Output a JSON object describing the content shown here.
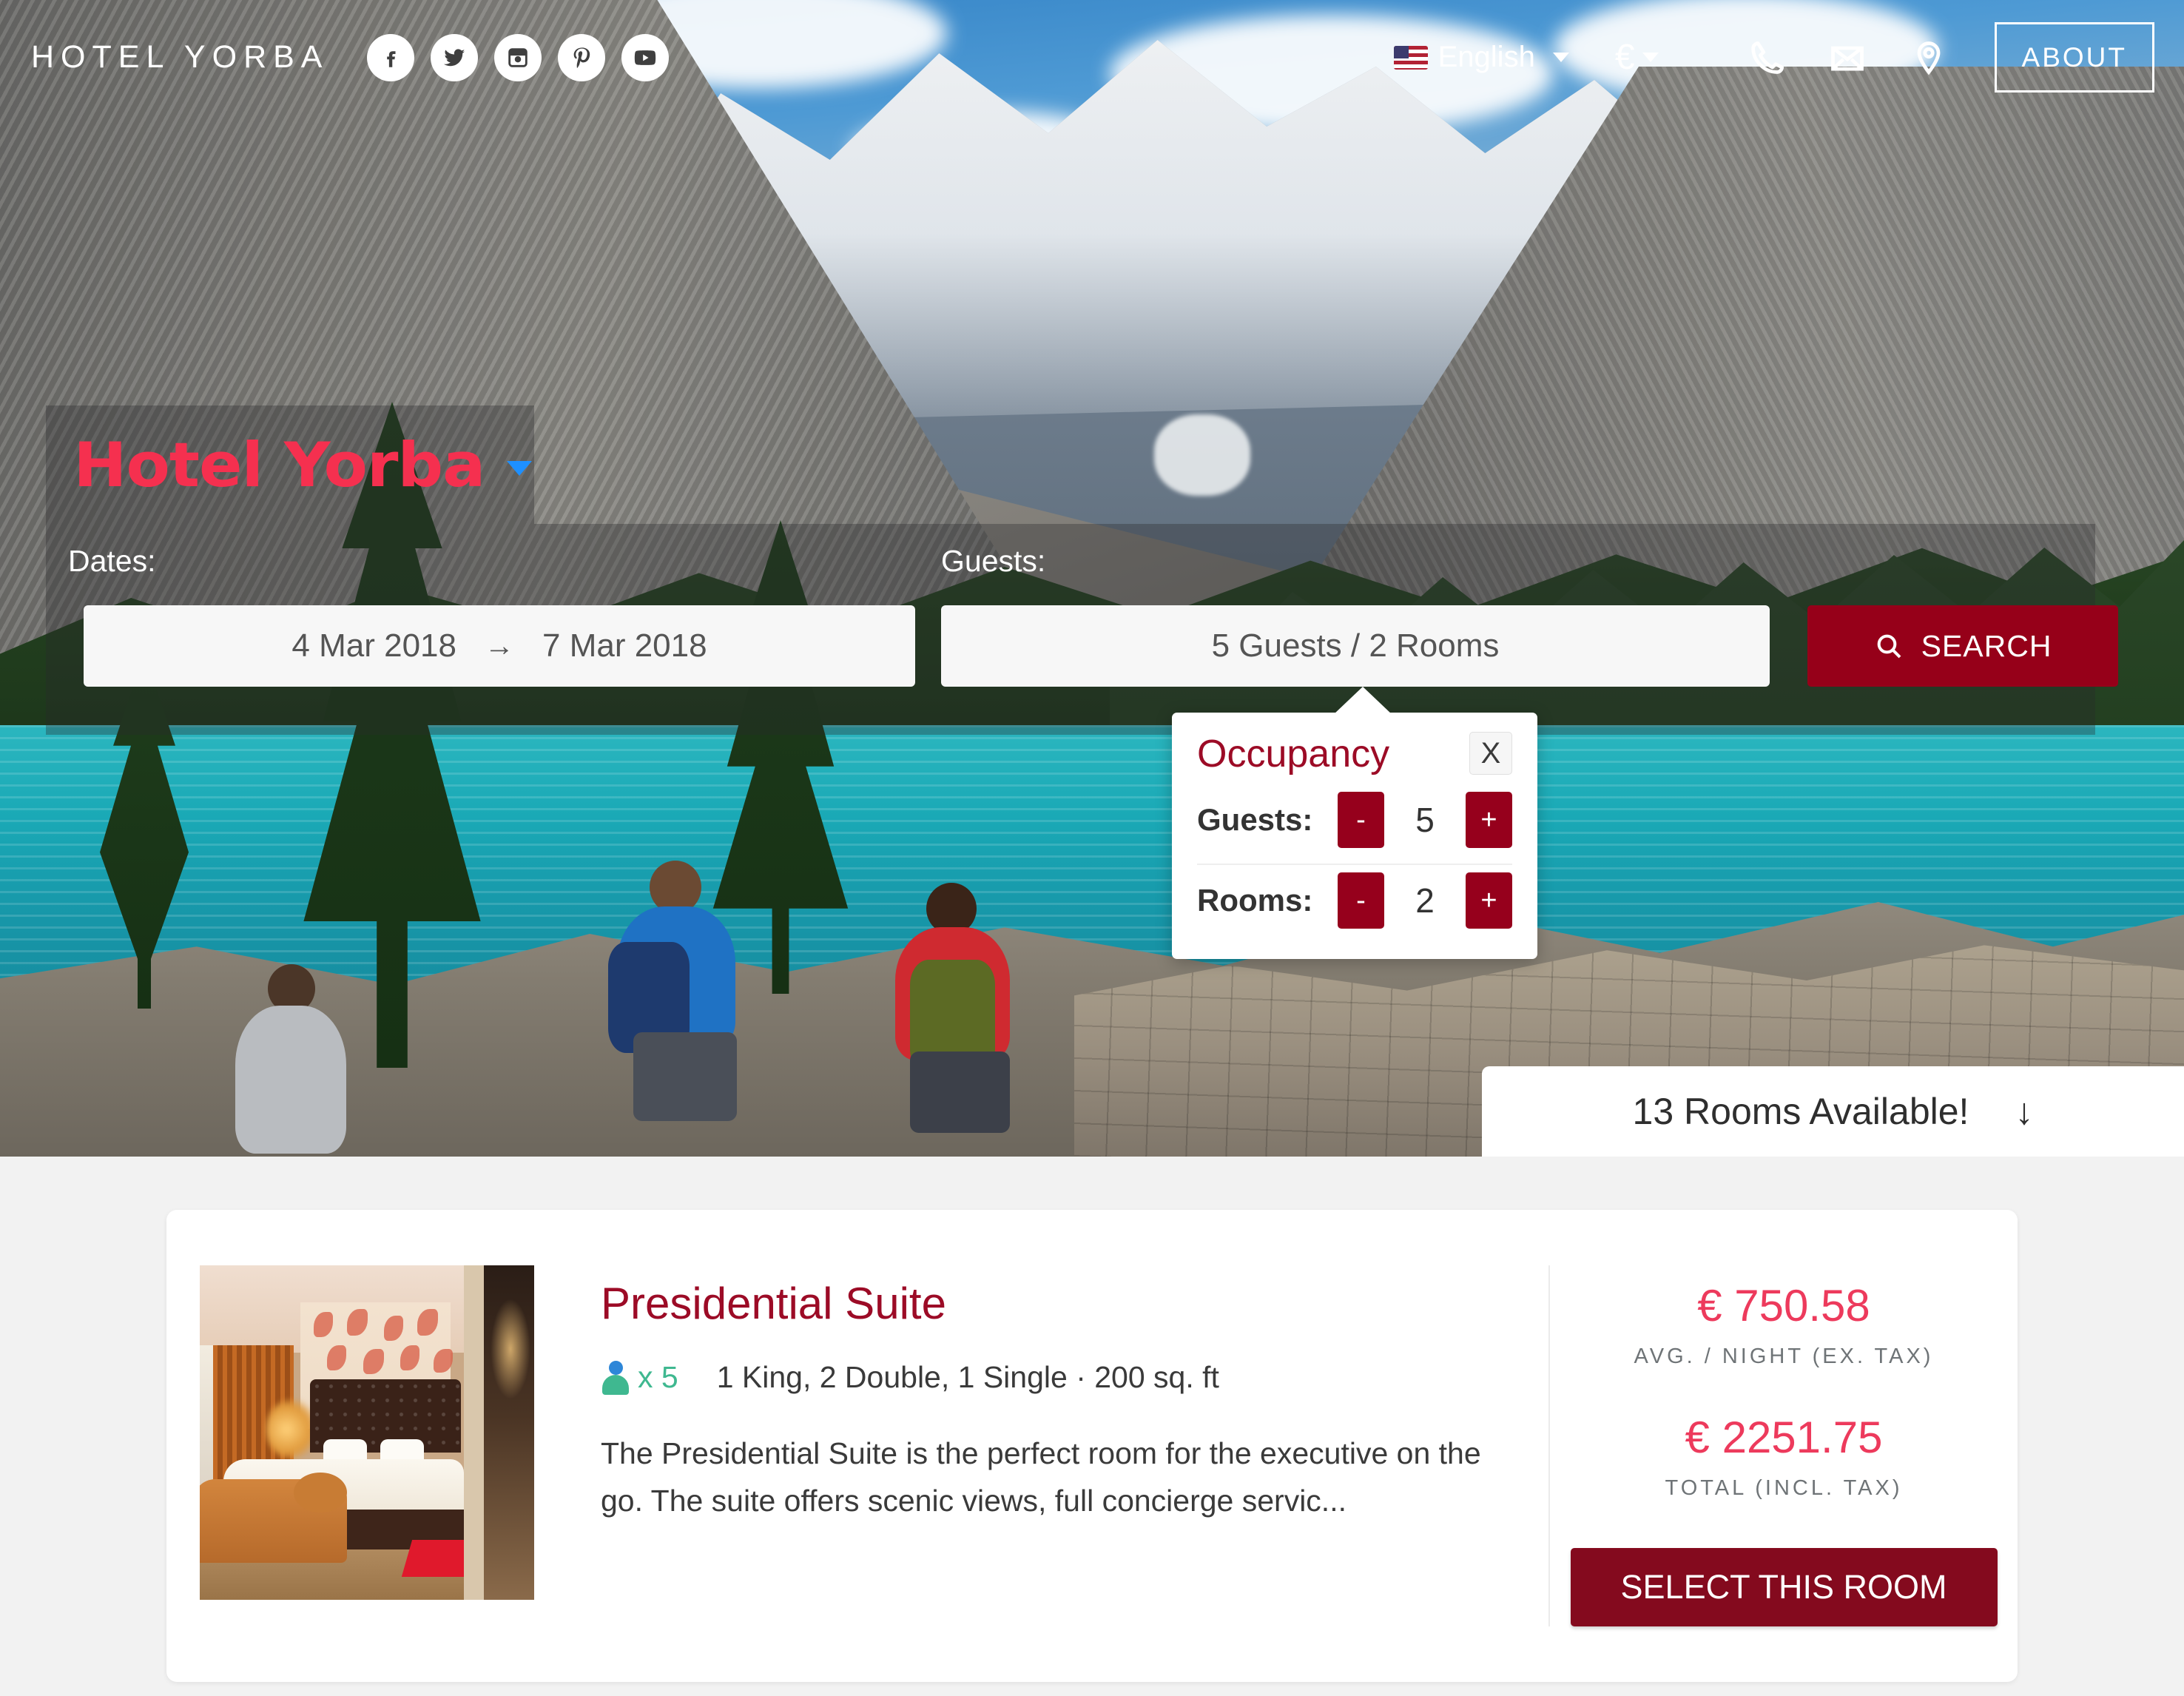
{
  "nav": {
    "brand": "HOTEL YORBA",
    "socials": [
      {
        "name": "facebook-icon",
        "label": "Facebook"
      },
      {
        "name": "twitter-icon",
        "label": "Twitter"
      },
      {
        "name": "instagram-icon",
        "label": "Instagram"
      },
      {
        "name": "pinterest-icon",
        "label": "Pinterest"
      },
      {
        "name": "youtube-icon",
        "label": "YouTube"
      }
    ],
    "language": "English",
    "language_flag": "us-flag",
    "currency": "€",
    "phone_icon": "phone-icon",
    "mail_icon": "mail-icon",
    "location_icon": "location-pin-icon",
    "about_label": "ABOUT"
  },
  "hero": {
    "hotel_logo": "Hotel Yorba",
    "logo_dropdown_icon": "chevron-down-icon"
  },
  "search": {
    "dates_label": "Dates:",
    "guests_label": "Guests:",
    "check_in": "4 Mar 2018",
    "date_separator": "→",
    "check_out": "7 Mar 2018",
    "guests_value": "5 Guests / 2 Rooms",
    "search_label": "SEARCH",
    "search_icon": "magnifier-icon"
  },
  "occupancy": {
    "title": "Occupancy",
    "close_label": "X",
    "rows": [
      {
        "label": "Guests:",
        "decrement": "-",
        "value": "5",
        "increment": "+"
      },
      {
        "label": "Rooms:",
        "decrement": "-",
        "value": "2",
        "increment": "+"
      }
    ]
  },
  "availability": {
    "text": "13 Rooms Available!",
    "arrow": "↓"
  },
  "room": {
    "title": "Presidential Suite",
    "guest_icon": "person-icon",
    "guest_count": "x 5",
    "specs": "1 King, 2 Double, 1 Single · 200 sq. ft",
    "description": "The Presidential Suite is the perfect room for the executive on the go. The suite offers scenic views, full concierge servic...",
    "avg_price": "€ 750.58",
    "avg_price_label": "AVG. / NIGHT (EX. TAX)",
    "total_price": "€ 2251.75",
    "total_price_label": "TOTAL (INCL. TAX)",
    "select_label": "SELECT THIS ROOM"
  },
  "colors": {
    "brand_red": "#960019",
    "accent_pink": "#ed3a5c",
    "logo_pink": "#f5304f",
    "teal": "#3fb890",
    "page_bg": "#f2f2f2"
  }
}
